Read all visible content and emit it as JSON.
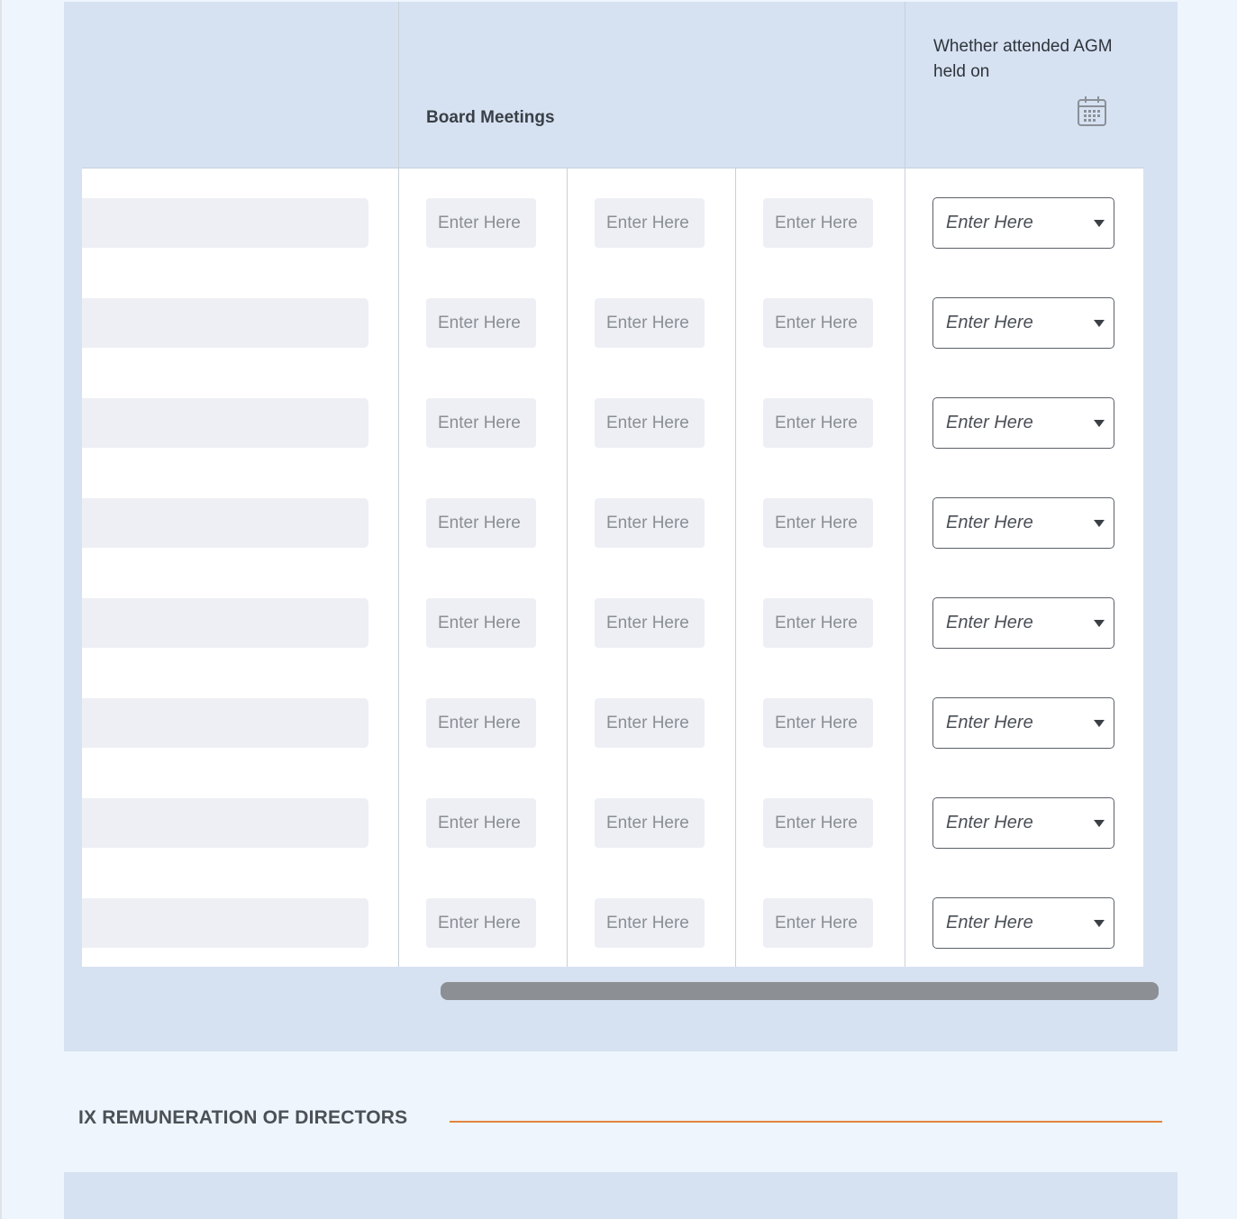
{
  "table": {
    "board_meetings_header": "Board Meetings",
    "agm_header": "Whether attended AGM held on",
    "cell_placeholder": "Enter Here",
    "select_placeholder": "Enter Here",
    "rows": [
      {
        "m1": "Enter Here",
        "m2": "Enter Here",
        "m3": "Enter Here",
        "agm": "Enter Here"
      },
      {
        "m1": "Enter Here",
        "m2": "Enter Here",
        "m3": "Enter Here",
        "agm": "Enter Here"
      },
      {
        "m1": "Enter Here",
        "m2": "Enter Here",
        "m3": "Enter Here",
        "agm": "Enter Here"
      },
      {
        "m1": "Enter Here",
        "m2": "Enter Here",
        "m3": "Enter Here",
        "agm": "Enter Here"
      },
      {
        "m1": "Enter Here",
        "m2": "Enter Here",
        "m3": "Enter Here",
        "agm": "Enter Here"
      },
      {
        "m1": "Enter Here",
        "m2": "Enter Here",
        "m3": "Enter Here",
        "agm": "Enter Here"
      },
      {
        "m1": "Enter Here",
        "m2": "Enter Here",
        "m3": "Enter Here",
        "agm": "Enter Here"
      },
      {
        "m1": "Enter Here",
        "m2": "Enter Here",
        "m3": "Enter Here",
        "agm": "Enter Here"
      }
    ]
  },
  "section": {
    "title": "IX  REMUNERATION OF DIRECTORS"
  },
  "icons": {
    "calendar": "calendar-icon",
    "dropdown": "caret-down-icon"
  },
  "colors": {
    "panel": "#d6e2f2",
    "accent_rule": "#e2843f",
    "scrollbar": "#8c8f93"
  }
}
